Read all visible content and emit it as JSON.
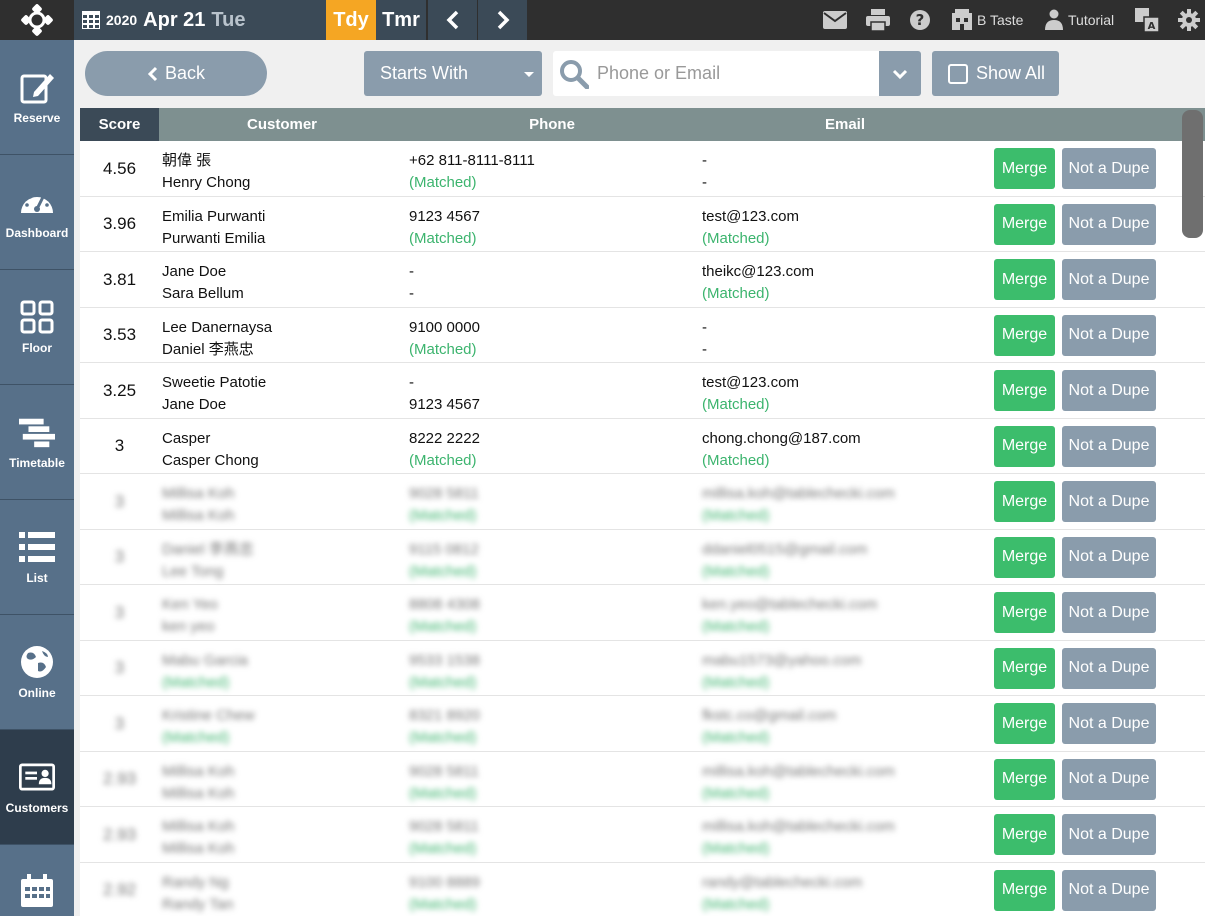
{
  "topbar": {
    "year": "2020",
    "month_day": "Apr 21",
    "weekday": "Tue",
    "today_label": "Tdy",
    "tomorrow_label": "Tmr",
    "venue_label": "B Taste",
    "tutorial_label": "Tutorial"
  },
  "sidebar": {
    "items": [
      {
        "label": "Reserve"
      },
      {
        "label": "Dashboard"
      },
      {
        "label": "Floor"
      },
      {
        "label": "Timetable"
      },
      {
        "label": "List"
      },
      {
        "label": "Online"
      },
      {
        "label": "Customers"
      }
    ]
  },
  "toolbar": {
    "back_label": "Back",
    "match_mode": "Starts With",
    "search_placeholder": "Phone or Email",
    "show_all_label": "Show All"
  },
  "table": {
    "headers": {
      "score": "Score",
      "customer": "Customer",
      "phone": "Phone",
      "email": "Email"
    },
    "merge_label": "Merge",
    "not_dupe_label": "Not a Dupe",
    "rows": [
      {
        "score": "4.56",
        "cust1": "朝偉 張",
        "cust2": "Henry Chong",
        "phone1": "+62 811-8111-8111",
        "phone2": "(Matched)",
        "email1": "-",
        "email2": "-"
      },
      {
        "score": "3.96",
        "cust1": "Emilia Purwanti",
        "cust2": "Purwanti Emilia",
        "phone1": "9123 4567",
        "phone2": "(Matched)",
        "email1": "test@123.com",
        "email2": "(Matched)"
      },
      {
        "score": "3.81",
        "cust1": "Jane Doe",
        "cust2": "Sara Bellum",
        "phone1": "-",
        "phone2": "-",
        "email1": "theikc@123.com",
        "email2": "(Matched)"
      },
      {
        "score": "3.53",
        "cust1": "Lee Danernaysa",
        "cust2": "Daniel 李燕忠",
        "phone1": "9100 0000",
        "phone2": "(Matched)",
        "email1": "-",
        "email2": "-"
      },
      {
        "score": "3.25",
        "cust1": "Sweetie Patotie",
        "cust2": "Jane Doe",
        "phone1": "-",
        "phone2": "9123 4567",
        "email1": "test@123.com",
        "email2": "(Matched)"
      },
      {
        "score": "3",
        "cust1": "Casper",
        "cust2": "Casper Chong",
        "phone1": "8222 2222",
        "phone2": "(Matched)",
        "email1": "chong.chong@187.com",
        "email2": "(Matched)"
      },
      {
        "score": "3",
        "cust1": "Millisa Koh",
        "cust2": "Millisa Koh",
        "phone1": "9028 5811",
        "phone2": "(Matched)",
        "email1": "millisa.koh@tablechecki.com",
        "email2": "(Matched)"
      },
      {
        "score": "3",
        "cust1": "Daniel 李燕忠",
        "cust2": "Lee Tong",
        "phone1": "9115 0812",
        "phone2": "(Matched)",
        "email1": "ddaniel0515@gmail.com",
        "email2": "(Matched)"
      },
      {
        "score": "3",
        "cust1": "Ken Yeo",
        "cust2": "ken yeo",
        "phone1": "8808 4308",
        "phone2": "(Matched)",
        "email1": "ken.yeo@tablechecki.com",
        "email2": "(Matched)"
      },
      {
        "score": "3",
        "cust1": "Mabu Garcia",
        "cust2": "(Matched)",
        "phone1": "9533 1538",
        "phone2": "(Matched)",
        "email1": "mabu1573@yahoo.com",
        "email2": "(Matched)"
      },
      {
        "score": "3",
        "cust1": "Kristine Chew",
        "cust2": "(Matched)",
        "phone1": "8321 8920",
        "phone2": "(Matched)",
        "email1": "fkstc.co@gmail.com",
        "email2": "(Matched)"
      },
      {
        "score": "2.93",
        "cust1": "Millisa Koh",
        "cust2": "Millisa Koh",
        "phone1": "9028 5811",
        "phone2": "(Matched)",
        "email1": "millisa.koh@tablechecki.com",
        "email2": "(Matched)"
      },
      {
        "score": "2.93",
        "cust1": "Millisa Koh",
        "cust2": "Millisa Koh",
        "phone1": "9028 5811",
        "phone2": "(Matched)",
        "email1": "millisa.koh@tablechecki.com",
        "email2": "(Matched)"
      },
      {
        "score": "2.92",
        "cust1": "Randy Ng",
        "cust2": "Randy Tan",
        "phone1": "9100 8889",
        "phone2": "(Matched)",
        "email1": "randy@tablechecki.com",
        "email2": "(Matched)"
      }
    ]
  }
}
